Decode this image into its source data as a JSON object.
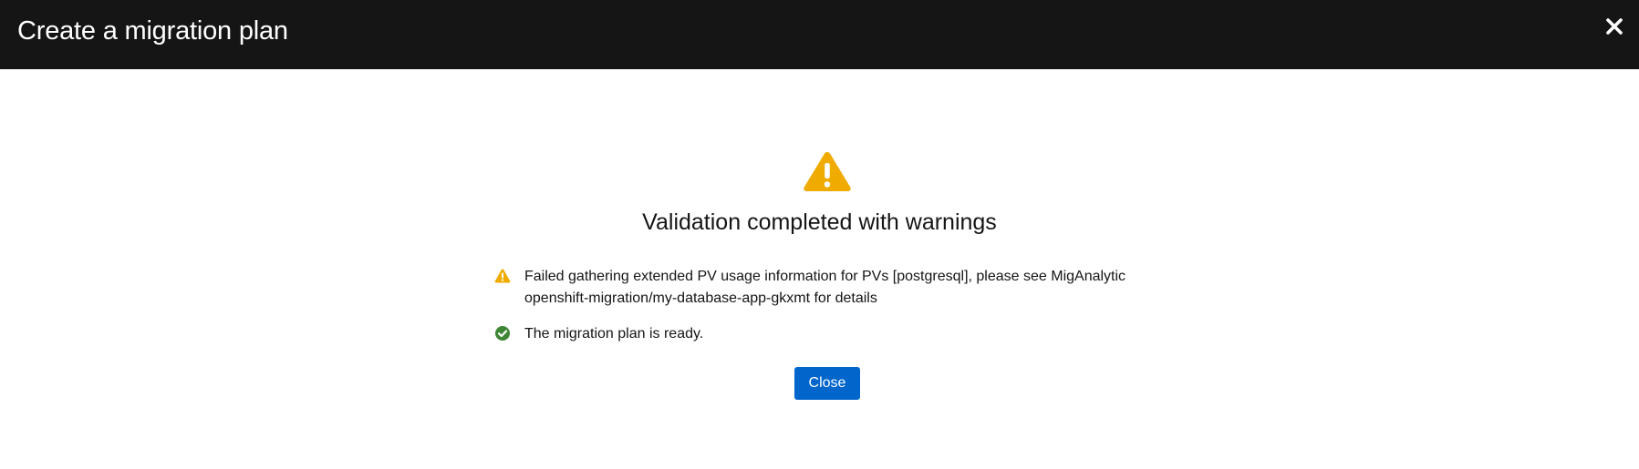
{
  "modal": {
    "title": "Create a migration plan",
    "close_icon": "close-icon"
  },
  "result": {
    "status_icon": "warning-triangle-icon",
    "title": "Validation completed with warnings",
    "messages": [
      {
        "icon": "warning-icon",
        "line1": "Failed gathering extended PV usage information for PVs [postgresql], please see MigAnalytic",
        "line2": "openshift-migration/my-database-app-gkxmt for details"
      },
      {
        "icon": "check-circle-icon",
        "line1": "The migration plan is ready."
      }
    ],
    "close_button_label": "Close"
  },
  "colors": {
    "header_bg": "#151515",
    "warning": "#f0ab00",
    "success": "#3e8635",
    "primary": "#0066cc"
  }
}
